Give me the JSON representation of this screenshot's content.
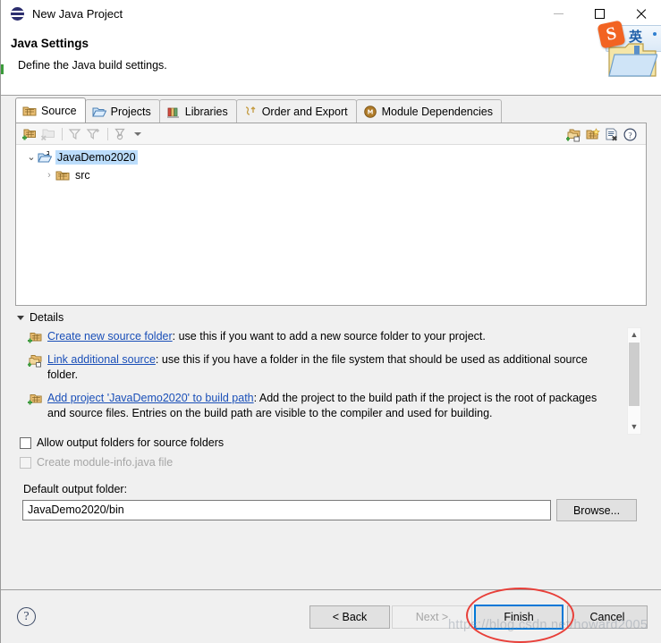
{
  "window": {
    "title": "New Java Project",
    "icon": "eclipse-icon",
    "minimize_label": "—",
    "maximize_label": "□",
    "close_label": "✕"
  },
  "banner": {
    "title": "Java Settings",
    "subtitle": "Define the Java build settings."
  },
  "ime_overlay": {
    "logo_letter": "S",
    "mode_label": "英"
  },
  "tabs": [
    {
      "label": "Source",
      "icon": "source-folder-icon",
      "active": true
    },
    {
      "label": "Projects",
      "icon": "open-folder-icon",
      "active": false
    },
    {
      "label": "Libraries",
      "icon": "books-icon",
      "active": false
    },
    {
      "label": "Order and Export",
      "icon": "order-export-icon",
      "active": false
    },
    {
      "label": "Module Dependencies",
      "icon": "module-icon",
      "active": false
    }
  ],
  "source_panel": {
    "toolbar_left": [
      {
        "name": "add-folder-icon",
        "enabled": true
      },
      {
        "name": "remove-folder-icon",
        "enabled": false
      },
      {
        "name": "filter-icon",
        "enabled": false
      },
      {
        "name": "add-filter-icon",
        "enabled": false
      },
      {
        "name": "configure-filter-icon",
        "enabled": false
      }
    ],
    "toolbar_right": [
      {
        "name": "link-source-icon"
      },
      {
        "name": "create-folder-icon"
      },
      {
        "name": "remove-entry-icon"
      },
      {
        "name": "help-icon"
      }
    ],
    "tree": [
      {
        "label": "JavaDemo2020",
        "icon": "java-project-icon",
        "level": 1,
        "expanded": true,
        "selected": true,
        "twisty": "⌄"
      },
      {
        "label": "src",
        "icon": "source-folder-icon",
        "level": 2,
        "expanded": false,
        "selected": false,
        "twisty": "›"
      }
    ]
  },
  "details": {
    "header": "Details",
    "items": [
      {
        "icon": "create-source-folder-icon",
        "link": "Create new source folder",
        "text": ": use this if you want to add a new source folder to your project."
      },
      {
        "icon": "link-source-icon",
        "link": "Link additional source",
        "text": ": use this if you have a folder in the file system that should be used as additional source folder."
      },
      {
        "icon": "add-build-path-icon",
        "link": "Add project 'JavaDemo2020' to build path",
        "text": ": Add the project to the build path if the project is the root of packages and source files. Entries on the build path are visible to the compiler and used for building."
      }
    ],
    "scroll_up": "▲",
    "scroll_down": "▼"
  },
  "checkboxes": [
    {
      "label": "Allow output folders for source folders",
      "checked": false,
      "enabled": true
    },
    {
      "label": "Create module-info.java file",
      "checked": false,
      "enabled": false
    }
  ],
  "output_folder": {
    "label": "Default output folder:",
    "value": "JavaDemo2020/bin",
    "placeholder": "",
    "browse_label": "Browse..."
  },
  "footer": {
    "help_label": "?",
    "back_label": "< Back",
    "next_label": "Next >",
    "finish_label": "Finish",
    "cancel_label": "Cancel"
  },
  "annotation": {
    "shape": "red-ellipse-around-finish",
    "color": "#e8403a"
  },
  "watermark": {
    "text": "https://blog.csdn.net/howard2005"
  },
  "colors": {
    "dialog_bg": "#f0f0f0",
    "panel_bg": "#ffffff",
    "selection_blue": "#bcddfb",
    "link_blue": "#1a4fb8",
    "focus_blue": "#0078d7",
    "annotation_red": "#e8403a"
  }
}
